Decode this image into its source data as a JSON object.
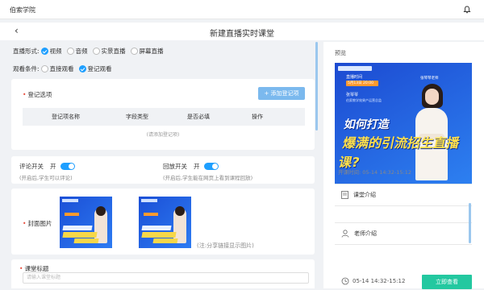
{
  "app": {
    "brand": "伯索学院",
    "page_title": "新建直播实时课堂"
  },
  "form": {
    "live_form": {
      "label": "直播形式:",
      "options": [
        "视频",
        "音频",
        "实景直播",
        "屏幕直播"
      ],
      "selected": "视频"
    },
    "watch_cond": {
      "label": "观看条件:",
      "options": [
        "直接观看",
        "登记观看"
      ],
      "selected": "登记观看"
    },
    "registration": {
      "title": "登记选项",
      "add_button": "+ 添加登记项",
      "columns": [
        "登记项名称",
        "字段类型",
        "是否必填",
        "操作"
      ],
      "empty_text": "(请添加登记项)"
    },
    "comment": {
      "label": "评论开关",
      "state": "开",
      "hint": "(开启后,学生可以评论)"
    },
    "replay": {
      "label": "回放开关",
      "state": "开",
      "hint": "(开启后,学生能在网页上看到课程回放)"
    },
    "cover": {
      "label": "封面图片",
      "note": "(注:分享链接显示图片)"
    },
    "course_title": {
      "label": "课堂标题",
      "placeholder": "请输入课堂标题"
    }
  },
  "preview": {
    "label": "预览",
    "banner": {
      "time_label": "直播时间",
      "date": "5月13日 20:00",
      "host": "张琴琴",
      "host_desc": "伯索教学效果产运营总监",
      "corner_text": "张琴琴老师",
      "headline1": "如何打造",
      "headline2": "爆满的引流招生直播课?"
    },
    "start_time": "开课时间: 05-14 14:32-15:12",
    "sections": [
      "课堂介绍",
      "老师介绍"
    ],
    "footer_time": "05-14 14:32-15:12",
    "enter_button": "立即查看"
  },
  "colors": {
    "accent": "#1e9fff",
    "enter": "#23c8a0",
    "required": "#e74c3c",
    "banner_blue": "#1c4ad1"
  }
}
